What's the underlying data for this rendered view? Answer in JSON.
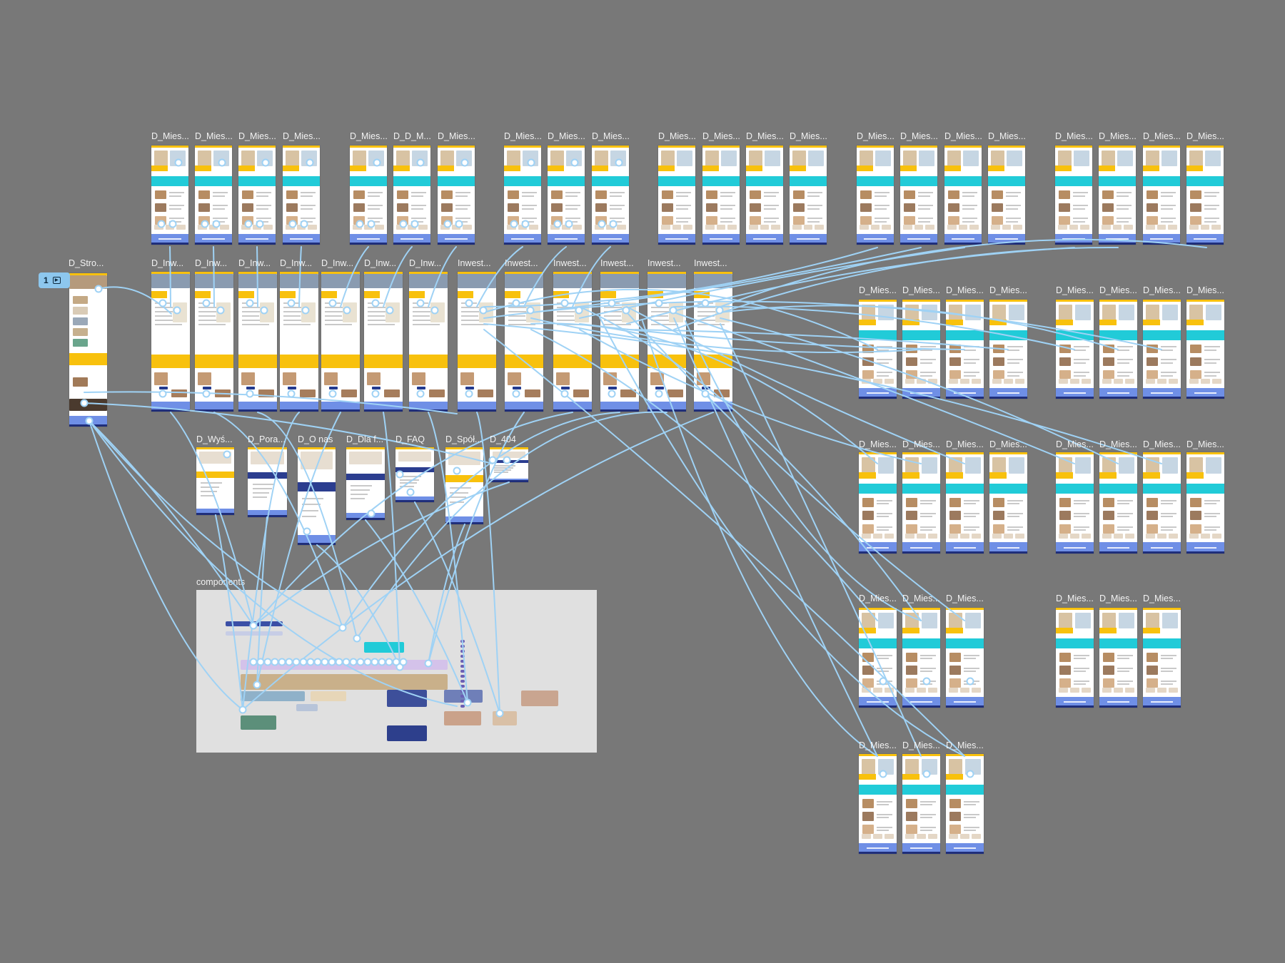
{
  "canvas": {
    "background": "#787878",
    "connector_color": "#9fd2f5",
    "accent_cyan": "#21cbd8",
    "accent_yellow": "#f8c10d",
    "accent_blue": "#6f8fe6",
    "accent_navy": "#233a8f"
  },
  "flow_start": {
    "badge_number": "1",
    "icon": "play-icon"
  },
  "rows": {
    "top_row": [
      "D_Mies...",
      "D_Mies...",
      "D_Mies...",
      "D_Mies...",
      "D_Mies...",
      "D_D_M...",
      "D_Mies...",
      "D_Mies...",
      "D_Mies...",
      "D_Mies...",
      "D_Mies...",
      "D_Mies...",
      "D_Mies...",
      "D_Mies...",
      "D_Mies...",
      "D_Mies...",
      "D_Mies...",
      "D_Mies...",
      "D_Mies...",
      "D_Mies...",
      "D_Mies...",
      "D_Mies..."
    ],
    "home_frame": "D_Stro...",
    "investments_row": [
      "D_Inw...",
      "D_Inw...",
      "D_Inw...",
      "D_Inw...",
      "D_Inw...",
      "D_Inw...",
      "D_Inw...",
      "Inwest...",
      "Inwest...",
      "Inwest...",
      "Inwest...",
      "Inwest...",
      "Inwest..."
    ],
    "right_block_1": [
      "D_Mies...",
      "D_Mies...",
      "D_Mies...",
      "D_Mies...",
      "D_Mies...",
      "D_Mies...",
      "D_Mies...",
      "D_Mies..."
    ],
    "right_block_2": [
      "D_Mies...",
      "D_Mies...",
      "D_Mies...",
      "D_Mies...",
      "D_Mies...",
      "D_Mies...",
      "D_Mies...",
      "D_Mies..."
    ],
    "right_block_3": [
      "D_Mies...",
      "D_Mies...",
      "D_Mies...",
      "D_Mies...",
      "D_Mies...",
      "D_Mies..."
    ],
    "right_block_4": [
      "D_Mies...",
      "D_Mies...",
      "D_Mies..."
    ],
    "misc_row": [
      "D_Wyś...",
      "D_Pora...",
      "D_O nas",
      "D_Dla f...",
      "D_FAQ",
      "D_Spół...",
      "D_404"
    ]
  },
  "components": {
    "label": "components"
  }
}
